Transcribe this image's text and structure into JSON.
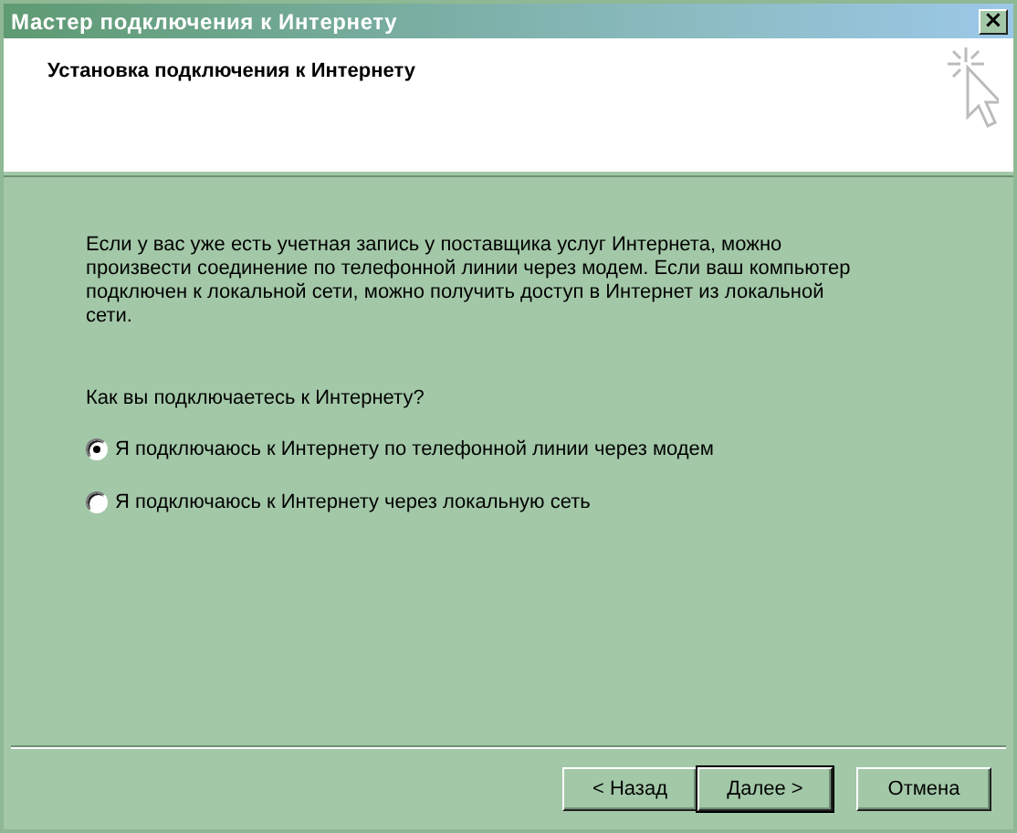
{
  "window": {
    "title": "Мастер подключения к Интернету",
    "close_button": "×"
  },
  "header": {
    "title": "Установка подключения к Интернету"
  },
  "intro": "Если у вас уже есть учетная запись у поставщика услуг Интернета, можно произвести соединение по телефонной линии через модем. Если ваш компьютер подключен к локальной сети, можно получить доступ в Интернет из локальной сети.",
  "question": "Как вы подключаетесь к Интернету?",
  "options": [
    {
      "label": "Я подключаюсь к Интернету по телефонной линии через модем",
      "selected": true
    },
    {
      "label": "Я подключаюсь к Интернету через локальную сеть",
      "selected": false
    }
  ],
  "buttons": [
    {
      "label": "< Назад",
      "default": false
    },
    {
      "label": "Далее >",
      "default": true
    },
    {
      "label": "Отмена",
      "default": false
    }
  ]
}
